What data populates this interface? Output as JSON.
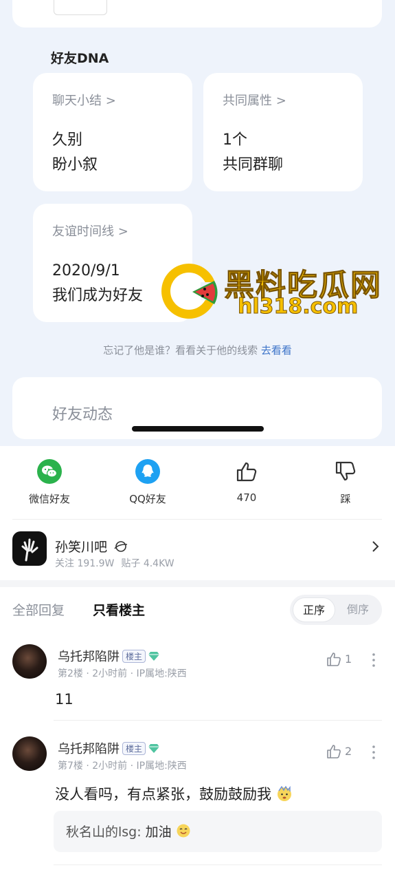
{
  "dna": {
    "title": "好友DNA",
    "cards": [
      {
        "title": "聊天小结 >",
        "line1": "久别",
        "line2": "盼小叙"
      },
      {
        "title": "共同属性 >",
        "line1": "1个",
        "line2": "共同群聊"
      },
      {
        "title": "友谊时间线 >",
        "line1": "2020/9/1",
        "line2": "我们成为好友"
      }
    ],
    "hint_text": "忘记了他是谁？看看关于他的线索 ",
    "hint_link": "去看看"
  },
  "activity": {
    "title": "好友动态"
  },
  "watermark": {
    "text": "黑料吃瓜网",
    "url": "hl318.com"
  },
  "share": {
    "items": [
      {
        "label": "微信好友",
        "icon": "wechat-icon"
      },
      {
        "label": "QQ好友",
        "icon": "qq-icon"
      },
      {
        "label": "470",
        "icon": "thumbs-up-icon"
      },
      {
        "label": "踩",
        "icon": "thumbs-down-icon"
      }
    ]
  },
  "forum": {
    "name": "孙笑川吧",
    "follow": "关注 191.9W",
    "posts": "贴子 4.4KW"
  },
  "filters": {
    "all": "全部回复",
    "op_only": "只看楼主",
    "order_asc": "正序",
    "order_desc": "倒序"
  },
  "comments": [
    {
      "author": "乌托邦陷阱",
      "badge": "楼主",
      "meta": "第2楼  ·  2小时前  ·  IP属地:陕西",
      "likes": "1",
      "text": "11"
    },
    {
      "author": "乌托邦陷阱",
      "badge": "楼主",
      "meta": "第7楼  ·  2小时前  ·  IP属地:陕西",
      "likes": "2",
      "text": "没人看吗，有点紧张，鼓励鼓励我",
      "reply_author": "秋名山的lsg:",
      "reply_text": " 加油"
    }
  ],
  "colors": {
    "accent_link": "#3d74c9",
    "wechat": "#2bb24c",
    "qq": "#1ea1f2",
    "watermark": "#f6c000"
  }
}
